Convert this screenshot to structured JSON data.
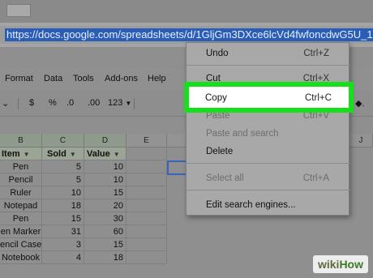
{
  "browser": {
    "url": "https://docs.google.com/spreadsheets/d/1GljGm3DXce6lcVd4fwfoncdwG5U_1"
  },
  "menubar": {
    "items": [
      "Format",
      "Data",
      "Tools",
      "Add-ons",
      "Help"
    ]
  },
  "toolbar": {
    "currency": "$",
    "percent": "%",
    "dec_less": ".0",
    "dec_more": ".00",
    "format_more": "123"
  },
  "columns": [
    "B",
    "C",
    "D",
    "E",
    "J"
  ],
  "table": {
    "headers": [
      "Item",
      "Sold",
      "Value"
    ],
    "rows": [
      [
        "Pen",
        "5",
        "10"
      ],
      [
        "Pencil",
        "5",
        "10"
      ],
      [
        "Ruler",
        "10",
        "15"
      ],
      [
        "Notepad",
        "18",
        "20"
      ],
      [
        "Pen",
        "15",
        "30"
      ],
      [
        "en Marker",
        "31",
        "60"
      ],
      [
        "encil Case",
        "3",
        "15"
      ],
      [
        "Notebook",
        "4",
        "18"
      ]
    ]
  },
  "context_menu": {
    "undo": {
      "label": "Undo",
      "shortcut": "Ctrl+Z"
    },
    "cut": {
      "label": "Cut",
      "shortcut": "Ctrl+X"
    },
    "copy": {
      "label": "Copy",
      "shortcut": "Ctrl+C"
    },
    "paste": {
      "label": "Paste",
      "shortcut": "Ctrl+V"
    },
    "paste_search": {
      "label": "Paste and search"
    },
    "delete": {
      "label": "Delete"
    },
    "select_all": {
      "label": "Select all",
      "shortcut": "Ctrl+A"
    },
    "edit_search": {
      "label": "Edit search engines..."
    }
  },
  "highlight_color": "#16e01c",
  "watermark": {
    "wiki": "wiki",
    "how": "How"
  }
}
